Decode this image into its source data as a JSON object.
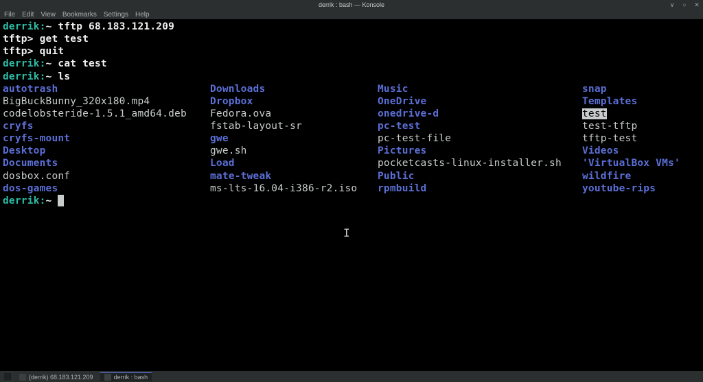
{
  "window": {
    "title": "derrik : bash — Konsole"
  },
  "menu": {
    "items": [
      "File",
      "Edit",
      "View",
      "Bookmarks",
      "Settings",
      "Help"
    ]
  },
  "terminal": {
    "lines": [
      {
        "prompt_user": "derrik",
        "prompt_path": "~",
        "cmd": "tftp 68.183.121.209"
      },
      {
        "tftp": "tftp>",
        "cmd": "get test"
      },
      {
        "tftp": "tftp>",
        "cmd": "quit"
      },
      {
        "prompt_user": "derrik",
        "prompt_path": "~",
        "cmd": "cat test"
      },
      {
        "prompt_user": "derrik",
        "prompt_path": "~",
        "cmd": "ls"
      }
    ],
    "ls": {
      "col0": [
        {
          "t": "autotrash",
          "k": "dir"
        },
        {
          "t": "BigBuckBunny_320x180.mp4",
          "k": "file"
        },
        {
          "t": "codelobsteride-1.5.1_amd64.deb",
          "k": "file"
        },
        {
          "t": "cryfs",
          "k": "dir"
        },
        {
          "t": "cryfs-mount",
          "k": "dir"
        },
        {
          "t": "Desktop",
          "k": "dir"
        },
        {
          "t": "Documents",
          "k": "dir"
        },
        {
          "t": "dosbox.conf",
          "k": "file"
        },
        {
          "t": "dos-games",
          "k": "dir"
        }
      ],
      "col1": [
        {
          "t": "Downloads",
          "k": "dir"
        },
        {
          "t": "Dropbox",
          "k": "dir"
        },
        {
          "t": "Fedora.ova",
          "k": "file"
        },
        {
          "t": "fstab-layout-sr",
          "k": "file"
        },
        {
          "t": "gwe",
          "k": "dir"
        },
        {
          "t": "gwe.sh",
          "k": "file"
        },
        {
          "t": "Load",
          "k": "dir"
        },
        {
          "t": "mate-tweak",
          "k": "dir"
        },
        {
          "t": "ms-lts-16.04-i386-r2.iso",
          "k": "file"
        }
      ],
      "col2": [
        {
          "t": "Music",
          "k": "dir"
        },
        {
          "t": "OneDrive",
          "k": "dir"
        },
        {
          "t": "onedrive-d",
          "k": "dir"
        },
        {
          "t": "pc-test",
          "k": "dir"
        },
        {
          "t": "pc-test-file",
          "k": "file"
        },
        {
          "t": "Pictures",
          "k": "dir"
        },
        {
          "t": "pocketcasts-linux-installer.sh",
          "k": "file"
        },
        {
          "t": "Public",
          "k": "dir"
        },
        {
          "t": "rpmbuild",
          "k": "dir"
        }
      ],
      "col3": [
        {
          "t": "snap",
          "k": "dir"
        },
        {
          "t": "Templates",
          "k": "dir"
        },
        {
          "t": "test",
          "k": "hl"
        },
        {
          "t": "test-tftp",
          "k": "file"
        },
        {
          "t": "tftp-test",
          "k": "file"
        },
        {
          "t": "Videos",
          "k": "dir"
        },
        {
          "t": "'VirtualBox VMs'",
          "k": "dir"
        },
        {
          "t": "wildfire",
          "k": "dir"
        },
        {
          "t": "youtube-rips",
          "k": "dir"
        }
      ]
    },
    "final_prompt": {
      "user": "derrik",
      "path": "~"
    }
  },
  "taskbar": {
    "items": [
      {
        "label": "(derrik) 68.183.121.209",
        "active": false
      },
      {
        "label": "derrik : bash",
        "active": true
      }
    ]
  }
}
